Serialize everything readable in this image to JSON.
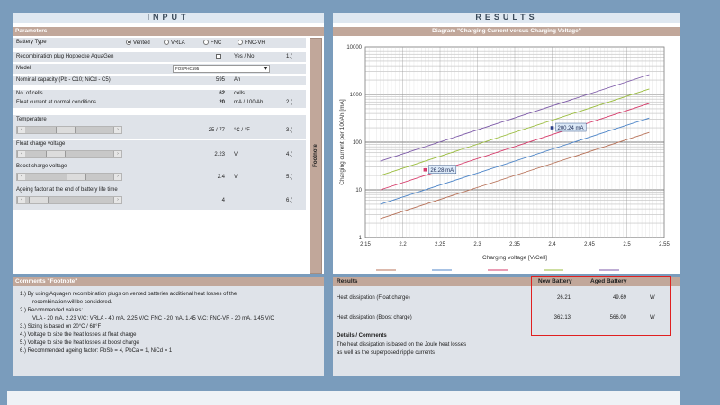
{
  "input": {
    "title": "INPUT",
    "parameters_header": "Parameters",
    "battery_type": {
      "label": "Battery Type",
      "options": [
        "Vented",
        "VRLA",
        "FNC",
        "FNC-VR"
      ],
      "selected": "Vented"
    },
    "recombination": {
      "label": "Recombination plug Hoppecke AquaGen",
      "value_label": "Yes / No",
      "note": "1.)",
      "checked": false
    },
    "model": {
      "label": "Model",
      "value": "FOSPHC595"
    },
    "nominal_capacity": {
      "label": "Nominal capacity (Pb - C10; NiCd - C5)",
      "value": "595",
      "unit": "Ah"
    },
    "no_cells": {
      "label": "No. of cells",
      "value": "62",
      "unit": "cells"
    },
    "float_current": {
      "label": "Float current at normal conditions",
      "value": "20",
      "unit": "mA / 100 Ah",
      "note": "2.)"
    },
    "temperature": {
      "label": "Temperature",
      "value": "25 / 77",
      "unit": "°C / °F",
      "note": "3.)",
      "level": 0.45
    },
    "float_voltage": {
      "label": "Float charge voltage",
      "value": "2.23",
      "unit": "V",
      "note": "4.)",
      "level": 0.3
    },
    "boost_voltage": {
      "label": "Boost charge voltage",
      "value": "2.4",
      "unit": "V",
      "note": "5.)",
      "level": 0.6
    },
    "ageing": {
      "label": "Ageing factor at the end of battery life time",
      "value": "4",
      "note": "6.)",
      "level": 0.05
    },
    "footnote_tab": "Footnote"
  },
  "comments": {
    "header": "Comments \"Footnote\"",
    "lines": [
      "1.)  By using Aquagen recombination plugs on vented batteries additional heat losses of the",
      "recombination will be considered.",
      "2.)  Recommended values:",
      "VLA - 20 mA, 2,23 V/C; VRLA - 40 mA, 2,25 V/C; FNC - 20 mA, 1,45 V/C; FNC-VR - 20 mA, 1,45 V/C",
      "3.)  Sizing is based on 20°C / 68°F",
      "4.)  Voltage to size the heat losses at float charge",
      "5.)  Voltage to size the heat losses at boost charge",
      "6.)  Recommended ageing factor: PbSb = 4, PbCa = 1, NiCd = 1"
    ]
  },
  "results": {
    "title": "RESULTS",
    "diagram_header": "Diagram \"Charging Current versus Charging Voltage\"",
    "table_header": "Results",
    "col_new": "New Battery",
    "col_aged": "Aged Battery",
    "rows": [
      {
        "label": "Heat dissipation (Float charge)",
        "new": "26.21",
        "aged": "49.69",
        "unit": "W"
      },
      {
        "label": "Heat dissipation (Boost charge)",
        "new": "362.13",
        "aged": "566.00",
        "unit": "W"
      }
    ],
    "details_header": "Details / Comments",
    "details_lines": [
      "The heat dissipation is based on the Joule heat losses",
      "as well as the superposed ripple currents"
    ]
  },
  "colors": {
    "frame": "#7a9cbc",
    "title_bg": "#dfe8f1",
    "section_header": "#c1a79a",
    "row_bg": "#dfe3e9",
    "highlight": "#e02020"
  },
  "chart_data": {
    "type": "line",
    "xlabel": "Charging voltage [V/Cell]",
    "ylabel": "Charging  current per 100Ah [mA]",
    "xlim": [
      2.15,
      2.55
    ],
    "ylim": [
      1,
      10000
    ],
    "y_scale": "log",
    "x_ticks": [
      "2.15",
      "2.2",
      "2.25",
      "2.3",
      "2.35",
      "2.4",
      "2.45",
      "2.5",
      "2.55"
    ],
    "y_ticks": [
      "1",
      "10",
      "100",
      "1000",
      "10000"
    ],
    "grid": true,
    "series": [
      {
        "color": "#b8735a",
        "x": [
          2.17,
          2.53
        ],
        "y": [
          2.5,
          160
        ]
      },
      {
        "color": "#4f86c8",
        "x": [
          2.17,
          2.53
        ],
        "y": [
          5,
          320
        ]
      },
      {
        "color": "#d63a6a",
        "x": [
          2.17,
          2.53
        ],
        "y": [
          10,
          650
        ]
      },
      {
        "color": "#9bbd3f",
        "x": [
          2.17,
          2.53
        ],
        "y": [
          20,
          1300
        ]
      },
      {
        "color": "#7d5aa8",
        "x": [
          2.17,
          2.53
        ],
        "y": [
          40,
          2600
        ]
      }
    ],
    "annotations": [
      {
        "text": "26.28 mA",
        "x": 2.23,
        "y": 26.28,
        "color": "#d63a6a"
      },
      {
        "text": "200.24 mA",
        "x": 2.4,
        "y": 200.24,
        "color": "#2a3f8a"
      }
    ]
  }
}
